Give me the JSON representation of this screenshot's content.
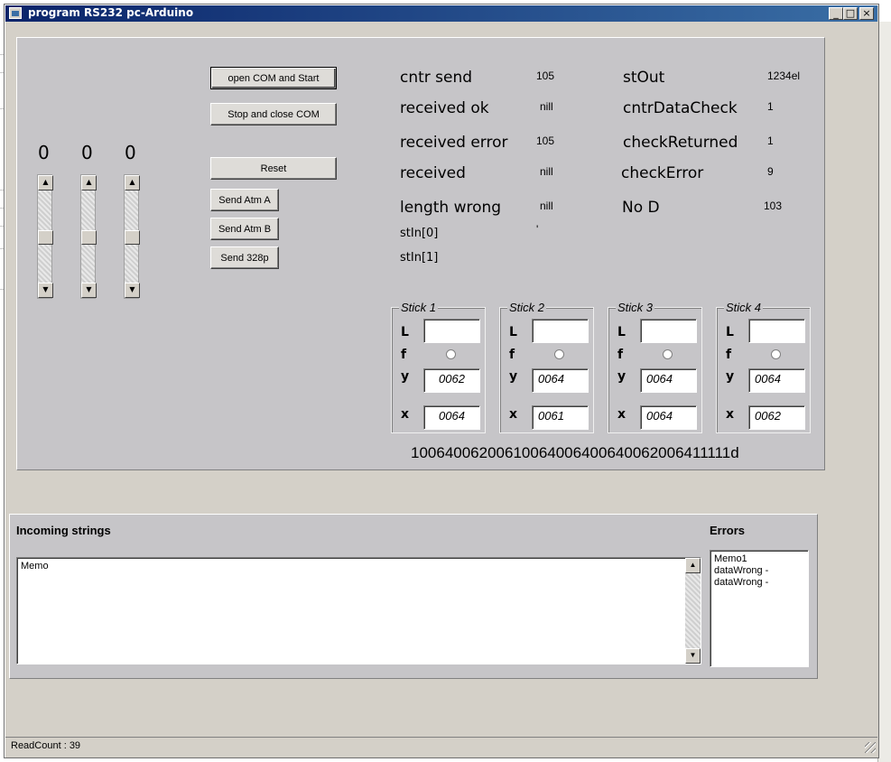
{
  "window": {
    "title": "program RS232 pc-Arduino",
    "minimize_label": "_",
    "maximize_label": "□",
    "close_label": "×"
  },
  "sliders": [
    {
      "value": "0"
    },
    {
      "value": "0"
    },
    {
      "value": "0"
    }
  ],
  "buttons": {
    "open_com": "open COM and Start",
    "stop_com": "Stop and close COM",
    "reset": "Reset",
    "send_atm_a": "Send Atm A",
    "send_atm_b": "Send Atm B",
    "send_328p": "Send 328p"
  },
  "stats": {
    "cntr_send_label": "cntr send",
    "cntr_send_value": "105",
    "received_ok_label": "received ok",
    "received_ok_value": "nill",
    "received_error_label": "received error",
    "received_error_value": "105",
    "received_label": "received",
    "received_value": "nill",
    "length_wrong_label": "length wrong",
    "length_wrong_value": "nill",
    "stin0_label": "stIn[0]",
    "stin0_value": "'",
    "stin1_label": "stIn[1]",
    "stout_label": "stOut",
    "stout_value": "1234el",
    "cntr_data_check_label": "cntrDataCheck",
    "cntr_data_check_value": "1",
    "check_returned_label": "checkReturned",
    "check_returned_value": "1",
    "check_error_label": "checkError",
    "check_error_value": "9",
    "no_d_label": "No D",
    "no_d_value": "103"
  },
  "sticks": [
    {
      "title": "Stick 1",
      "l_label": "L",
      "f_label": "f",
      "y_label": "y",
      "x_label": "x",
      "l_value": "",
      "y_value": "0062",
      "x_value": "0064"
    },
    {
      "title": "Stick 2",
      "l_label": "L",
      "f_label": "f",
      "y_label": "y",
      "x_label": "x",
      "l_value": "",
      "y_value": "0064",
      "x_value": "0061"
    },
    {
      "title": "Stick 3",
      "l_label": "L",
      "f_label": "f",
      "y_label": "y",
      "x_label": "x",
      "l_value": "",
      "y_value": "0064",
      "x_value": "0064"
    },
    {
      "title": "Stick 4",
      "l_label": "L",
      "f_label": "f",
      "y_label": "y",
      "x_label": "x",
      "l_value": "",
      "y_value": "0064",
      "x_value": "0062"
    }
  ],
  "data_string": "10064006200610064006400640062006411111d",
  "incoming": {
    "label": "Incoming strings",
    "memo_text": "Memo"
  },
  "errors": {
    "label": "Errors",
    "lines": [
      "Memo1",
      "dataWrong -",
      "dataWrong -"
    ]
  },
  "status": {
    "read_count": "ReadCount : 39"
  }
}
